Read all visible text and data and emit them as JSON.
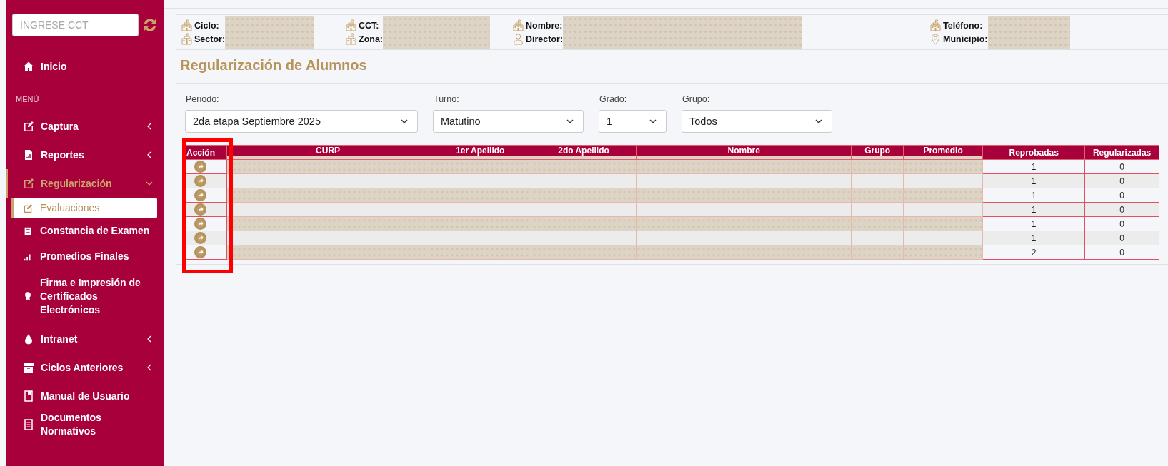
{
  "sidebar": {
    "search": {
      "placeholder": "INGRESE CCT"
    },
    "items": [
      {
        "kind": "link",
        "label": "Inicio",
        "selected": false
      },
      {
        "kind": "heading",
        "label": "MENÚ"
      },
      {
        "kind": "group",
        "label": "Captura",
        "expanded": false,
        "selected": false
      },
      {
        "kind": "group",
        "label": "Reportes",
        "expanded": false,
        "selected": false
      },
      {
        "kind": "group",
        "label": "Regularización",
        "expanded": true,
        "selected": true,
        "children": [
          {
            "kind": "link",
            "label": "Evaluaciones",
            "selected": true
          },
          {
            "kind": "link",
            "label": "Constancia de Examen",
            "selected": false
          },
          {
            "kind": "link",
            "label": "Promedios Finales",
            "selected": false
          },
          {
            "kind": "link",
            "label": "Firma e Impresión de Certificados Electrónicos",
            "selected": false
          }
        ]
      },
      {
        "kind": "group",
        "label": "Intranet",
        "expanded": false,
        "selected": false
      },
      {
        "kind": "group",
        "label": "Ciclos Anteriores",
        "expanded": false,
        "selected": false
      },
      {
        "kind": "link",
        "label": "Manual de Usuario",
        "selected": false
      },
      {
        "kind": "link",
        "label": "Documentos Normativos",
        "selected": false
      }
    ]
  },
  "school_info": {
    "groups": [
      {
        "fields": [
          {
            "label": "Ciclo:"
          },
          {
            "label": "Sector:"
          }
        ]
      },
      {
        "fields": [
          {
            "label": "CCT:"
          },
          {
            "label": "Zona:"
          }
        ]
      },
      {
        "fields": [
          {
            "label": "Nombre:"
          },
          {
            "label": "Director:"
          }
        ]
      },
      {
        "fields": [
          {
            "label": "Teléfono:"
          },
          {
            "label": "Municipio:"
          }
        ]
      }
    ]
  },
  "page_title": "Regularización de Alumnos",
  "filters": [
    {
      "label": "Periodo:",
      "value": "2da etapa Septiembre 2025"
    },
    {
      "label": "Turno:",
      "value": "Matutino"
    },
    {
      "label": "Grado:",
      "value": "1"
    },
    {
      "label": "Grupo:",
      "value": "Todos"
    }
  ],
  "table": {
    "columns": [
      {
        "label": "Acción",
        "highlighted": true,
        "redacted": false
      },
      {
        "highlighted": false,
        "redacted": false
      },
      {
        "label": "CURP",
        "highlighted": false,
        "redacted": true
      },
      {
        "label": "1er Apellido",
        "highlighted": false,
        "redacted": true
      },
      {
        "label": "2do Apellido",
        "highlighted": false,
        "redacted": true
      },
      {
        "label": "Nombre",
        "highlighted": false,
        "redacted": true
      },
      {
        "label": "Grupo",
        "highlighted": false,
        "redacted": true
      },
      {
        "label": "Promedio",
        "highlighted": false,
        "redacted": true
      },
      {
        "label": "Reprobadas",
        "highlighted": false,
        "redacted": false
      },
      {
        "label": "Regularizadas",
        "highlighted": false,
        "redacted": false
      }
    ],
    "rows": [
      {
        "reprobadas": "1",
        "regularizadas": "0"
      },
      {
        "reprobadas": "1",
        "regularizadas": "0"
      },
      {
        "reprobadas": "1",
        "regularizadas": "0"
      },
      {
        "reprobadas": "1",
        "regularizadas": "0"
      },
      {
        "reprobadas": "1",
        "regularizadas": "0"
      },
      {
        "reprobadas": "1",
        "regularizadas": "0"
      },
      {
        "reprobadas": "2",
        "regularizadas": "0"
      }
    ]
  }
}
